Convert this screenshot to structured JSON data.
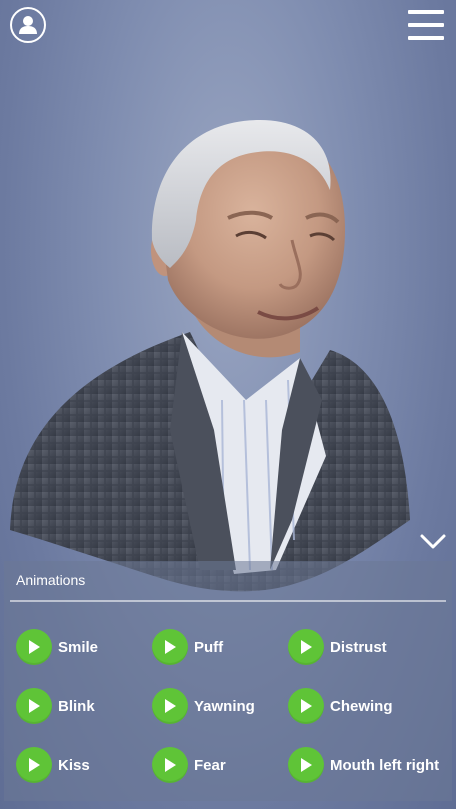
{
  "header": {
    "profile_icon": "user-icon",
    "menu_icon": "hamburger-menu-icon"
  },
  "viewer": {
    "collapse_icon": "chevron-down-icon"
  },
  "panel": {
    "title": "Animations",
    "items": [
      {
        "label": "Smile",
        "icon": "play-icon"
      },
      {
        "label": "Puff",
        "icon": "play-icon"
      },
      {
        "label": "Distrust",
        "icon": "play-icon"
      },
      {
        "label": "Blink",
        "icon": "play-icon"
      },
      {
        "label": "Yawning",
        "icon": "play-icon"
      },
      {
        "label": "Chewing",
        "icon": "play-icon"
      },
      {
        "label": "Kiss",
        "icon": "play-icon"
      },
      {
        "label": "Fear",
        "icon": "play-icon"
      },
      {
        "label": "Mouth left right",
        "icon": "play-icon"
      }
    ]
  },
  "colors": {
    "play_button": "#5fc437",
    "background": "#7f8db0",
    "panel": "#6c7896"
  }
}
